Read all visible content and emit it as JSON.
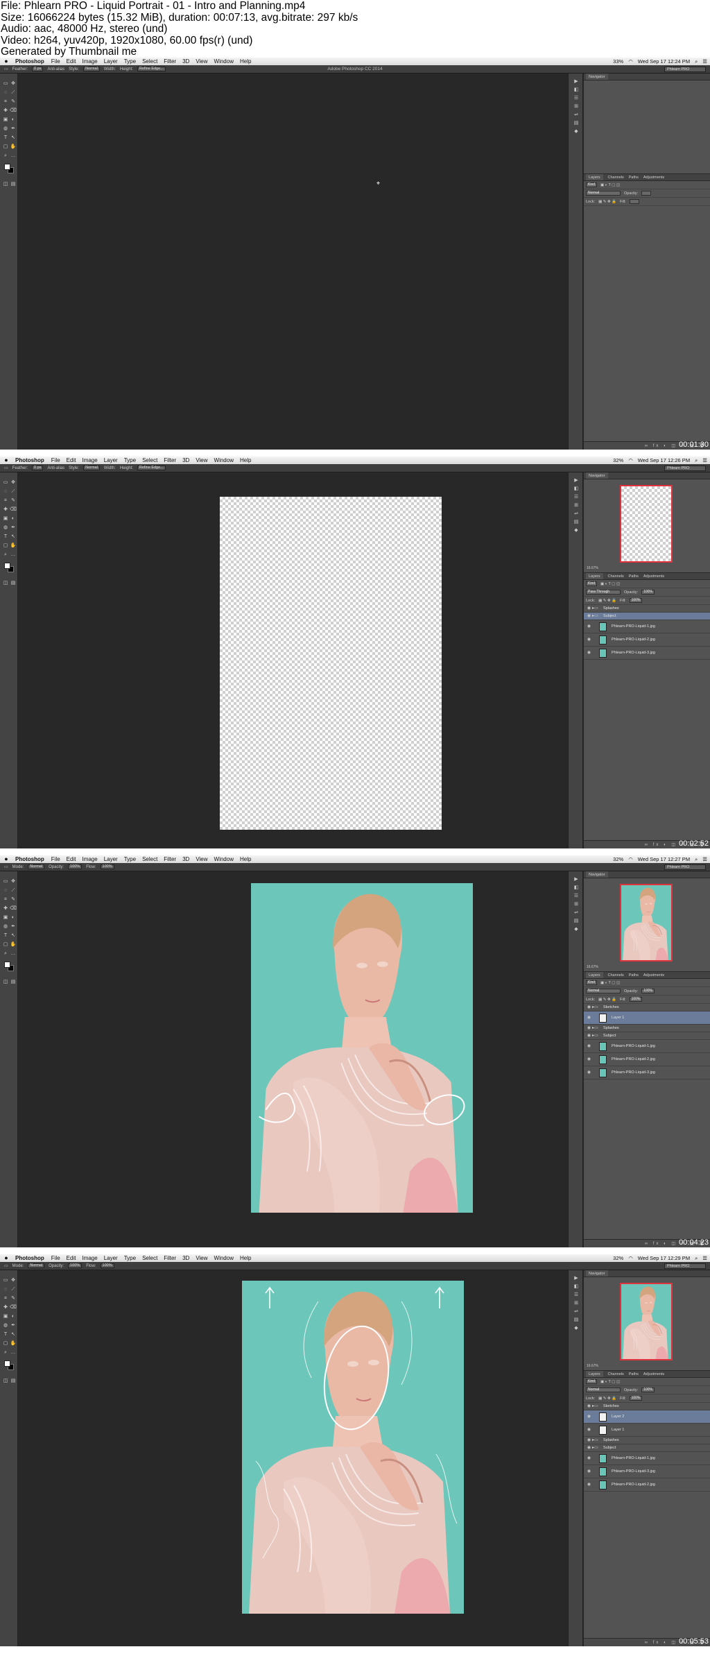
{
  "header": {
    "lines": [
      "File: Phlearn PRO - Liquid Portrait - 01 - Intro and Planning.mp4",
      "Size: 16066224 bytes (15.32 MiB), duration: 00:07:13, avg.bitrate: 297 kb/s",
      "Audio: aac, 48000 Hz, stereo (und)",
      "Video: h264, yuv420p, 1920x1080, 60.00 fps(r) (und)",
      "Generated by Thumbnail me"
    ]
  },
  "menubar": {
    "app": "Photoshop",
    "items": [
      "File",
      "Edit",
      "Image",
      "Layer",
      "Type",
      "Select",
      "Filter",
      "3D",
      "View",
      "Window",
      "Help"
    ],
    "battery": "33%",
    "battery2": "32%"
  },
  "frames": [
    {
      "timestamp": "00:01:30",
      "clock": "Wed Sep 17  12:24 PM",
      "window_title": "Adobe Photoshop CC 2014",
      "workspace": "Phlearn PRO",
      "options": {
        "feather_label": "Feather:",
        "feather_value": "0 px",
        "antialias": "Anti-alias",
        "style_label": "Style:",
        "style_value": "Normal",
        "width": "Width:",
        "height": "Height:",
        "refine": "Refine Edge..."
      },
      "panel_tabs": [
        "Layers",
        "Channels",
        "Paths",
        "Adjustments"
      ],
      "nav_tab": "Navigator",
      "kind": "Kind",
      "blend": "Normal",
      "opacity_label": "Opacity:",
      "lock_label": "Lock:",
      "fill_label": "Fill:",
      "layers": []
    },
    {
      "timestamp": "00:02:52",
      "clock": "Wed Sep 17  12:26 PM",
      "workspace": "Phlearn PRO",
      "options": {
        "feather_label": "Feather:",
        "feather_value": "0 px",
        "antialias": "Anti-alias",
        "style_label": "Style:",
        "style_value": "Normal",
        "width": "Width:",
        "height": "Height:",
        "refine": "Refine Edge..."
      },
      "panel_tabs": [
        "Layers",
        "Channels",
        "Paths",
        "Adjustments"
      ],
      "nav_tab": "Navigator",
      "zoom": "16.67%",
      "kind": "Kind",
      "blend": "Pass Through",
      "opacity_label": "Opacity:",
      "opacity": "100%",
      "lock_label": "Lock:",
      "fill_label": "Fill:",
      "fill": "100%",
      "layers": [
        {
          "name": "Splashes",
          "type": "group"
        },
        {
          "name": "Subject",
          "type": "group",
          "selected": true
        },
        {
          "name": "Phlearn-PRO-Liquid-1.jpg",
          "type": "image"
        },
        {
          "name": "Phlearn-PRO-Liquid-2.jpg",
          "type": "image"
        },
        {
          "name": "Phlearn-PRO-Liquid-3.jpg",
          "type": "image"
        }
      ]
    },
    {
      "timestamp": "00:04:23",
      "clock": "Wed Sep 17  12:27 PM",
      "workspace": "Phlearn PRO",
      "options": {
        "mode_label": "Mode:",
        "mode_value": "Normal",
        "opacity_label": "Opacity:",
        "opacity": "100%",
        "flow_label": "Flow:",
        "flow": "100%"
      },
      "panel_tabs": [
        "Layers",
        "Channels",
        "Paths",
        "Adjustments"
      ],
      "nav_tab": "Navigator",
      "zoom": "16.67%",
      "kind": "Kind",
      "blend": "Normal",
      "opacity_label": "Opacity:",
      "opacity": "100%",
      "lock_label": "Lock:",
      "fill_label": "Fill:",
      "fill": "100%",
      "layers": [
        {
          "name": "Sketches",
          "type": "group"
        },
        {
          "name": "Layer 1",
          "type": "white",
          "selected": true
        },
        {
          "name": "Splashes",
          "type": "group"
        },
        {
          "name": "Subject",
          "type": "group"
        },
        {
          "name": "Phlearn-PRO-Liquid-1.jpg",
          "type": "image"
        },
        {
          "name": "Phlearn-PRO-Liquid-2.jpg",
          "type": "image"
        },
        {
          "name": "Phlearn-PRO-Liquid-3.jpg",
          "type": "image"
        }
      ]
    },
    {
      "timestamp": "00:05:53",
      "clock": "Wed Sep 17  12:29 PM",
      "workspace": "Phlearn PRO",
      "options": {
        "mode_label": "Mode:",
        "mode_value": "Normal",
        "opacity_label": "Opacity:",
        "opacity": "100%",
        "flow_label": "Flow:",
        "flow": "100%"
      },
      "panel_tabs": [
        "Layers",
        "Channels",
        "Paths",
        "Adjustments"
      ],
      "nav_tab": "Navigator",
      "zoom": "16.67%",
      "kind": "Kind",
      "blend": "Normal",
      "opacity_label": "Opacity:",
      "opacity": "100%",
      "lock_label": "Lock:",
      "fill_label": "Fill:",
      "fill": "100%",
      "layers": [
        {
          "name": "Sketches",
          "type": "group"
        },
        {
          "name": "Layer 2",
          "type": "white",
          "selected": true
        },
        {
          "name": "Layer 1",
          "type": "white"
        },
        {
          "name": "Splashes",
          "type": "group"
        },
        {
          "name": "Subject",
          "type": "group"
        },
        {
          "name": "Phlearn-PRO-Liquid-1.jpg",
          "type": "image"
        },
        {
          "name": "Phlearn-PRO-Liquid-3.jpg",
          "type": "image"
        },
        {
          "name": "Phlearn-PRO-Liquid-2.jpg",
          "type": "image"
        }
      ]
    }
  ],
  "colors": {
    "ps_bg": "#282828",
    "panel": "#535353",
    "selection": "#6a7c99",
    "backdrop": "#6cc7ba",
    "nav_frame": "#e0323c"
  }
}
